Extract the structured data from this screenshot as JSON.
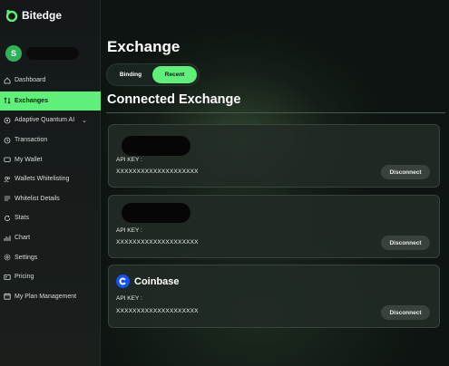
{
  "brand": {
    "name": "Bitedge",
    "accent": "#5ef078"
  },
  "user": {
    "initial": "S"
  },
  "nav": {
    "items": [
      {
        "label": "Dashboard",
        "icon": "home-icon"
      },
      {
        "label": "Exchanges",
        "icon": "swap-arrows-icon",
        "active": true
      },
      {
        "label": "Adaptive Quantum AI",
        "icon": "ai-chip-icon",
        "has_chevron": true,
        "chevron": "⌄"
      },
      {
        "label": "Transaction",
        "icon": "history-icon"
      },
      {
        "label": "My Wallet",
        "icon": "wallet-icon"
      },
      {
        "label": "Wallets Whitelisting",
        "icon": "users-icon"
      },
      {
        "label": "Whitelist Details",
        "icon": "list-icon"
      },
      {
        "label": "Stats",
        "icon": "refresh-icon"
      },
      {
        "label": "Chart",
        "icon": "bar-chart-icon"
      },
      {
        "label": "Settings",
        "icon": "gear-icon"
      },
      {
        "label": "Pricing",
        "icon": "pricing-card-icon"
      },
      {
        "label": "My Plan Management",
        "icon": "calendar-icon"
      }
    ]
  },
  "main": {
    "title": "Exchange",
    "tabs": [
      {
        "label": "Binding",
        "active": false
      },
      {
        "label": "Recent",
        "active": true
      }
    ],
    "section_title": "Connected Exchange",
    "exchanges": [
      {
        "name": "",
        "redacted": true,
        "api_key_label": "API KEY :",
        "api_key_value": "XXXXXXXXXXXXXXXXXXXX",
        "action": "Disconnect"
      },
      {
        "name": "",
        "redacted": true,
        "api_key_label": "API KEY :",
        "api_key_value": "XXXXXXXXXXXXXXXXXXXX",
        "action": "Disconnect"
      },
      {
        "name": "Coinbase",
        "redacted": false,
        "logo": "coinbase-logo-icon",
        "logo_color": "#1652f0",
        "api_key_label": "API KEY :",
        "api_key_value": "XXXXXXXXXXXXXXXXXXXX",
        "action": "Disconnect"
      }
    ]
  }
}
